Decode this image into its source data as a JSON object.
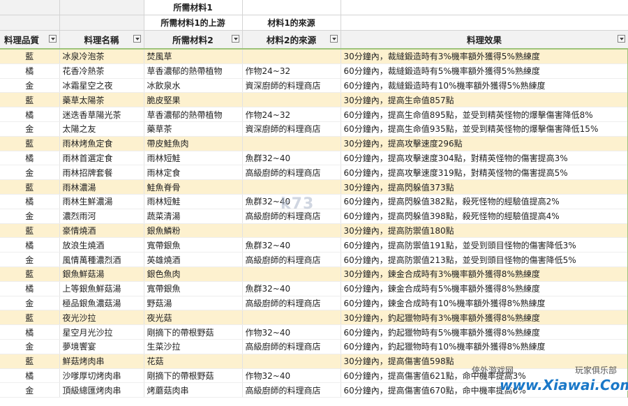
{
  "header": {
    "row1": {
      "col3": "所需材料1"
    },
    "row2": {
      "col3": "所需材料1的上游",
      "col4": "材料1的來源"
    },
    "row3": {
      "col1": "料理品質",
      "col2": "料理名稱",
      "col3": "所需材料2",
      "col4": "材料2的來源",
      "col5": "料理效果"
    }
  },
  "rows": [
    {
      "q": "藍",
      "name": "冰泉冷泡茶",
      "m": "焚風草",
      "src": "",
      "fx": "30分鐘內，裁縫鍛造時有3%機率額外獲得5%熟練度"
    },
    {
      "q": "橘",
      "name": "花香冷熱茶",
      "m": "草香濃郁的熱帶植物",
      "src": "作物24~32",
      "fx": "60分鐘內，裁縫鍛造時有5%機率額外獲得5%熟練度"
    },
    {
      "q": "金",
      "name": "冰霜星空之夜",
      "m": "冰飲泉水",
      "src": "資深廚師的料理商店",
      "fx": "60分鐘內，裁縫鍛造時有10%機率額外獲得5%熟練度"
    },
    {
      "q": "藍",
      "name": "藥草太陽茶",
      "m": "脆皮堅果",
      "src": "",
      "fx": "30分鐘內，提高生命值857點"
    },
    {
      "q": "橘",
      "name": "迷迭香草陽光茶",
      "m": "草香濃郁的熱帶植物",
      "src": "作物24~32",
      "fx": "60分鐘內，提高生命值895點，並受到精英怪物的爆擊傷害降低8%"
    },
    {
      "q": "金",
      "name": "太陽之友",
      "m": "藥草茶",
      "src": "資深廚師的料理商店",
      "fx": "60分鐘內，提高生命值935點，並受到精英怪物的爆擊傷害降低15%"
    },
    {
      "q": "藍",
      "name": "雨林烤魚定食",
      "m": "帶皮鮭魚肉",
      "src": "",
      "fx": "30分鐘內，提高攻擊速度296點"
    },
    {
      "q": "橘",
      "name": "雨林首選定食",
      "m": "雨林短鮭",
      "src": "魚群32~40",
      "fx": "60分鐘內，提高攻擊速度304點，對精英怪物的傷害提高3%"
    },
    {
      "q": "金",
      "name": "雨林招牌套餐",
      "m": "雨林定食",
      "src": "高級廚師的料理商店",
      "fx": "60分鐘內，提高攻擊速度319點，對精英怪物的傷害提高5%"
    },
    {
      "q": "藍",
      "name": "雨林濃湯",
      "m": "鮭魚脊骨",
      "src": "",
      "fx": "30分鐘內，提高閃躲值373點"
    },
    {
      "q": "橘",
      "name": "雨林生鮮濃湯",
      "m": "雨林短鮭",
      "src": "魚群32~40",
      "fx": "60分鐘內，提高閃躲值382點，殺死怪物的經驗值提高2%"
    },
    {
      "q": "金",
      "name": "濃烈雨河",
      "m": "蔬菜清湯",
      "src": "高級廚師的料理商店",
      "fx": "60分鐘內，提高閃躲值398點，殺死怪物的經驗值提高4%"
    },
    {
      "q": "藍",
      "name": "豪情燒酒",
      "m": "銀魚鱗粉",
      "src": "",
      "fx": "30分鐘內，提高防禦值180點"
    },
    {
      "q": "橘",
      "name": "放浪生燒酒",
      "m": "寬帶銀魚",
      "src": "魚群32~40",
      "fx": "60分鐘內，提高防禦值191點，並受到頭目怪物的傷害降低3%"
    },
    {
      "q": "金",
      "name": "風情萬種濃烈酒",
      "m": "英雄燒酒",
      "src": "高級廚師的料理商店",
      "fx": "60分鐘內，提高防禦值213點，並受到頭目怪物的傷害降低5%"
    },
    {
      "q": "藍",
      "name": "銀魚鮮菇湯",
      "m": "銀色魚肉",
      "src": "",
      "fx": "30分鐘內，鍊金合成時有3%機率額外獲得8%熟練度"
    },
    {
      "q": "橘",
      "name": "上等銀魚鮮菇湯",
      "m": "寬帶銀魚",
      "src": "魚群32~40",
      "fx": "60分鐘內，鍊金合成時有5%機率額外獲得8%熟練度"
    },
    {
      "q": "金",
      "name": "極品銀魚濃菇湯",
      "m": "野菇湯",
      "src": "高級廚師的料理商店",
      "fx": "60分鐘內，鍊金合成時有10%機率額外獲得8%熟練度"
    },
    {
      "q": "藍",
      "name": "夜光沙拉",
      "m": "夜光菇",
      "src": "",
      "fx": "30分鐘內，釣起獵物時有3%機率額外獲得8%熟練度"
    },
    {
      "q": "橘",
      "name": "星空月光沙拉",
      "m": "剛摘下的帶根野菇",
      "src": "作物32~40",
      "fx": "60分鐘內，釣起獵物時有5%機率額外獲得8%熟練度"
    },
    {
      "q": "金",
      "name": "夢境饗宴",
      "m": "生菜沙拉",
      "src": "高級廚師的料理商店",
      "fx": "60分鐘內，釣起獵物時有10%機率額外獲得8%熟練度"
    },
    {
      "q": "藍",
      "name": "鮮菇烤肉串",
      "m": "花菇",
      "src": "",
      "fx": "30分鐘內，提高傷害值598點"
    },
    {
      "q": "橘",
      "name": "沙嗲厚切烤肉串",
      "m": "剛摘下的帶根野菇",
      "src": "作物32~40",
      "fx": "60分鐘內，提高傷害值621點，命中機率提高3%"
    },
    {
      "q": "金",
      "name": "頂級總匯烤肉串",
      "m": "烤蘑菇肉串",
      "src": "高級廚師的料理商店",
      "fx": "60分鐘內，提高傷害值670點，命中機率提高6%"
    }
  ],
  "watermarks": {
    "center": "k73",
    "corner_left": "俠外游戏网",
    "corner_right": "玩家俱乐部",
    "corner_url": "www.Xiawai.Com"
  }
}
